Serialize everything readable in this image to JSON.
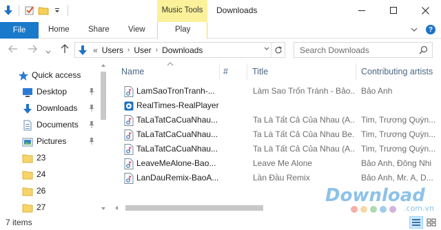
{
  "window": {
    "context_tab_group": "Music Tools",
    "title": "Downloads"
  },
  "ribbon": {
    "tabs": [
      "File",
      "Home",
      "Share",
      "View",
      "Play"
    ]
  },
  "address": {
    "prefix": "«",
    "path": [
      "Users",
      "User",
      "Downloads"
    ]
  },
  "search": {
    "placeholder": "Search Downloads"
  },
  "nav": {
    "items": [
      {
        "label": "Quick access",
        "icon": "star-icon",
        "pinned": false
      },
      {
        "label": "Desktop",
        "icon": "desktop-icon",
        "pinned": true
      },
      {
        "label": "Downloads",
        "icon": "download-arrow-icon",
        "pinned": true
      },
      {
        "label": "Documents",
        "icon": "documents-icon",
        "pinned": true
      },
      {
        "label": "Pictures",
        "icon": "pictures-icon",
        "pinned": true
      },
      {
        "label": "23",
        "icon": "folder-icon",
        "pinned": false
      },
      {
        "label": "24",
        "icon": "folder-icon",
        "pinned": false
      },
      {
        "label": "26",
        "icon": "folder-icon",
        "pinned": false
      },
      {
        "label": "27",
        "icon": "folder-icon",
        "pinned": false
      }
    ]
  },
  "columns": {
    "name": "Name",
    "number": "#",
    "title": "Title",
    "artists": "Contributing artists"
  },
  "files": [
    {
      "name": "LamSaoTronTranh-...",
      "icon": "audio-file-icon",
      "title": "Làm Sao Trốn Tránh - Bảo...",
      "artists": "Bảo Anh"
    },
    {
      "name": "RealTimes-RealPlayer",
      "icon": "realplayer-icon",
      "title": "",
      "artists": ""
    },
    {
      "name": "TaLaTatCaCuaNhau...",
      "icon": "audio-file-icon",
      "title": "Ta Là Tất Cả Của Nhau (A...",
      "artists": "Tim, Trương Quỳn..."
    },
    {
      "name": "TaLaTatCaCuaNhau...",
      "icon": "audio-file-icon",
      "title": "Ta Là Tất Cả Của Nhau Be...",
      "artists": "Tim, Trương Quỳn..."
    },
    {
      "name": "TaLaTatCaCuaNhau...",
      "icon": "audio-file-icon",
      "title": "Ta Là Tất Cả Của Nhau (A...",
      "artists": "Tim, Trương Quỳn..."
    },
    {
      "name": "LeaveMeAlone-Bao...",
      "icon": "audio-file-icon",
      "title": "Leave Me Alone",
      "artists": "Bảo Anh, Đông Nhi"
    },
    {
      "name": "LanDauRemix-BaoA...",
      "icon": "audio-file-icon",
      "title": "Lần Đầu Remix",
      "artists": "Bảo Anh, Mr. A, D..."
    }
  ],
  "status": {
    "item_count": "7 items"
  },
  "watermark": {
    "text": "Download",
    "domain": ".com.vn"
  }
}
